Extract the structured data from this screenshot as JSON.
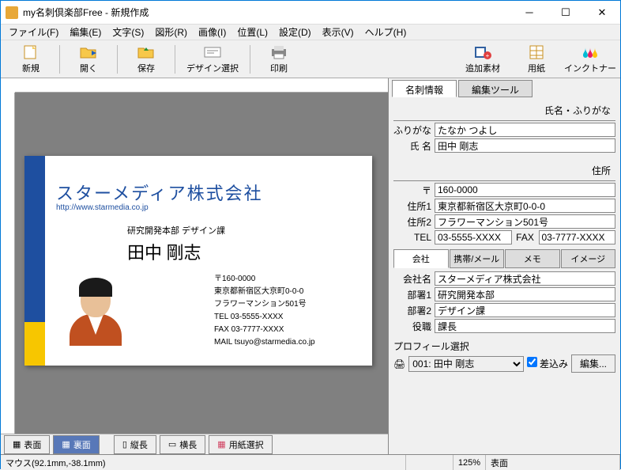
{
  "title": "my名刺倶楽部Free - 新規作成",
  "menu": [
    "ファイル(F)",
    "編集(E)",
    "文字(S)",
    "図形(R)",
    "画像(I)",
    "位置(L)",
    "設定(D)",
    "表示(V)",
    "ヘルプ(H)"
  ],
  "toolbar": {
    "new": "新規",
    "open": "開く",
    "save": "保存",
    "design": "デザイン選択",
    "print": "印刷",
    "add": "追加素材",
    "paper": "用紙",
    "ink": "インクトナー"
  },
  "sideBtns": {
    "front": "表面",
    "back": "裏面",
    "vert": "縦長",
    "horiz": "横長",
    "paper": "用紙選択"
  },
  "rtabs": {
    "info": "名刺情報",
    "edit": "編集ツール"
  },
  "sections": {
    "name": "氏名・ふりがな",
    "addr": "住所"
  },
  "labels": {
    "furigana": "ふりがな",
    "name": "氏 名",
    "postal": "〒",
    "addr1": "住所1",
    "addr2": "住所2",
    "tel": "TEL",
    "fax": "FAX",
    "company": "会社名",
    "dept1": "部署1",
    "dept2": "部署2",
    "role": "役職"
  },
  "subtabs": {
    "company": "会社",
    "mobile": "携帯/メール",
    "memo": "メモ",
    "image": "イメージ"
  },
  "fields": {
    "furigana": "たなか つよし",
    "name": "田中 剛志",
    "postal": "160-0000",
    "addr1": "東京都新宿区大京町0-0-0",
    "addr2": "フラワーマンション501号",
    "tel": "03-5555-XXXX",
    "fax": "03-7777-XXXX",
    "company": "スターメディア株式会社",
    "dept1": "研究開発本部",
    "dept2": "デザイン課",
    "role": "課長"
  },
  "profile": {
    "label": "プロフィール選択",
    "value": "001: 田中 剛志",
    "check": "差込み",
    "edit": "編集..."
  },
  "card": {
    "company": "スターメディア株式会社",
    "url": "http://www.starmedia.co.jp",
    "dept": "研究開発本部  デザイン課",
    "name": "田中 剛志",
    "postal": "〒160-0000",
    "addr1": "東京都新宿区大京町0-0-0",
    "addr2": "フラワーマンション501号",
    "tel": "TEL 03-5555-XXXX",
    "fax": "FAX 03-7777-XXXX",
    "mail": "MAIL tsuyo@starmedia.co.jp"
  },
  "status": {
    "mouse": "マウス(92.1mm,-38.1mm)",
    "zoom": "125%",
    "side": "表面"
  }
}
